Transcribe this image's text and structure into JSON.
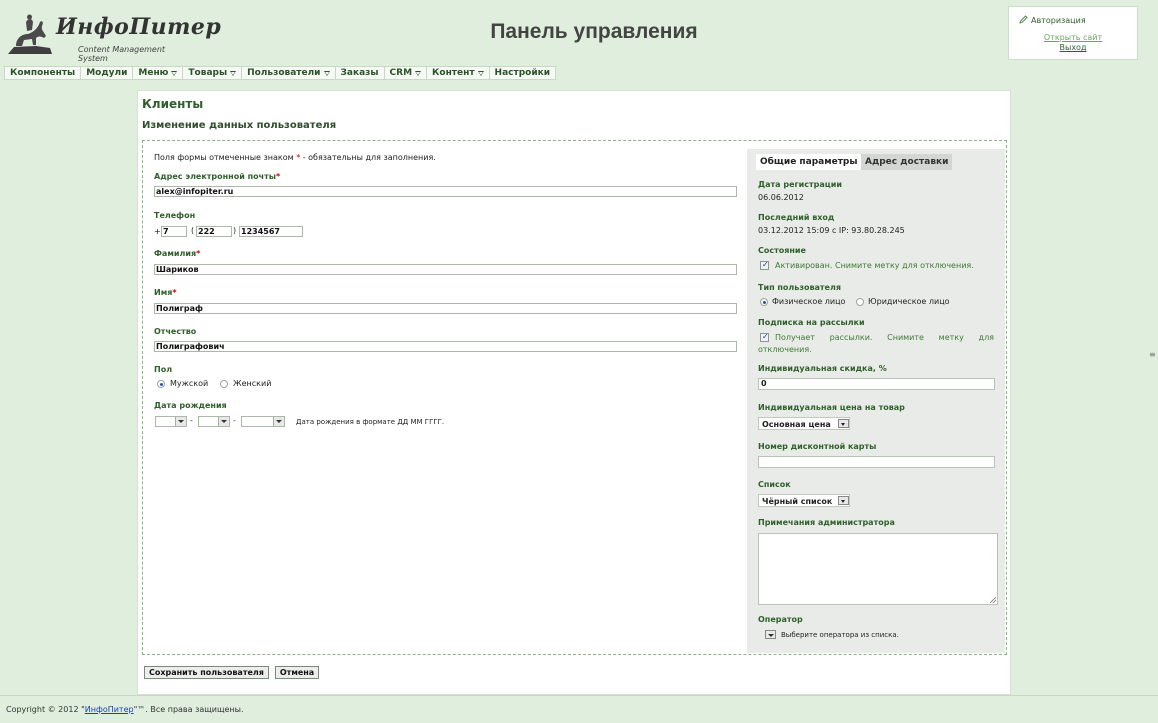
{
  "header": {
    "logo_name": "ИнфоПитер",
    "logo_subtitle": "Content Management System",
    "page_title": "Панель управления",
    "auth": {
      "title": "Авторизация",
      "open_site": "Открыть сайт",
      "logout": "Выход"
    }
  },
  "menu": {
    "items": [
      {
        "label": "Компоненты",
        "dropdown": false
      },
      {
        "label": "Модули",
        "dropdown": false
      },
      {
        "label": "Меню",
        "dropdown": true
      },
      {
        "label": "Товары",
        "dropdown": true
      },
      {
        "label": "Пользователи",
        "dropdown": true
      },
      {
        "label": "Заказы",
        "dropdown": false
      },
      {
        "label": "CRM",
        "dropdown": true
      },
      {
        "label": "Контент",
        "dropdown": true
      },
      {
        "label": "Настройки",
        "dropdown": false
      }
    ]
  },
  "main": {
    "title": "Клиенты",
    "subtitle": "Изменение данных пользователя",
    "required_note_prefix": "Поля формы отмеченные знаком",
    "required_mark": "*",
    "required_note_suffix": "- обязательны для заполнения.",
    "form": {
      "email_label": "Адрес электронной почты",
      "email_value": "alex@infopiter.ru",
      "phone_label": "Телефон",
      "phone_plus": "+",
      "phone_country": "7",
      "phone_code": "222",
      "phone_number": "1234567",
      "phone_open_paren": "(",
      "phone_close_paren": ")",
      "lastname_label": "Фамилия",
      "lastname_value": "Шариков",
      "firstname_label": "Имя",
      "firstname_value": "Полиграф",
      "middlename_label": "Отчество",
      "middlename_value": "Полиграфович",
      "gender_label": "Пол",
      "gender_male": "Мужской",
      "gender_female": "Женский",
      "birthdate_label": "Дата рождения",
      "date_separator": "-",
      "birthdate_hint": "Дата рождения в формате ДД ММ ГГГГ."
    },
    "sidebar": {
      "tab_general": "Общие параметры",
      "tab_delivery": "Адрес доставки",
      "reg_date_label": "Дата регистрации",
      "reg_date_value": "06.06.2012",
      "last_login_label": "Последний вход",
      "last_login_value": "03.12.2012 15:09 с IP: 93.80.28.245",
      "status_label": "Состояние",
      "status_text": "Активирован. Снимите метку для отключения.",
      "user_type_label": "Тип пользователя",
      "user_type_individual": "Физическое лицо",
      "user_type_legal": "Юридическое лицо",
      "newsletter_label": "Подписка на рассылки",
      "newsletter_text_line1": "Получает рассылки. Снимите метку для",
      "newsletter_text_line2": "отключения.",
      "discount_label": "Индивидуальная скидка, %",
      "discount_value": "0",
      "price_label": "Индивидуальная цена на товар",
      "price_value": "Основная цена",
      "card_label": "Номер дисконтной карты",
      "card_value": "",
      "list_label": "Список",
      "list_value": "Чёрный список",
      "notes_label": "Примечания администратора",
      "operator_label": "Оператор",
      "operator_hint": "Выберите оператора из списка."
    },
    "buttons": {
      "save": "Сохранить пользователя",
      "cancel": "Отмена"
    }
  },
  "footer": {
    "copyright_prefix": "Copyright © 2012 \"",
    "brand_link": "ИнфоПитер",
    "copyright_suffix": "\"™. Все права защищены."
  }
}
